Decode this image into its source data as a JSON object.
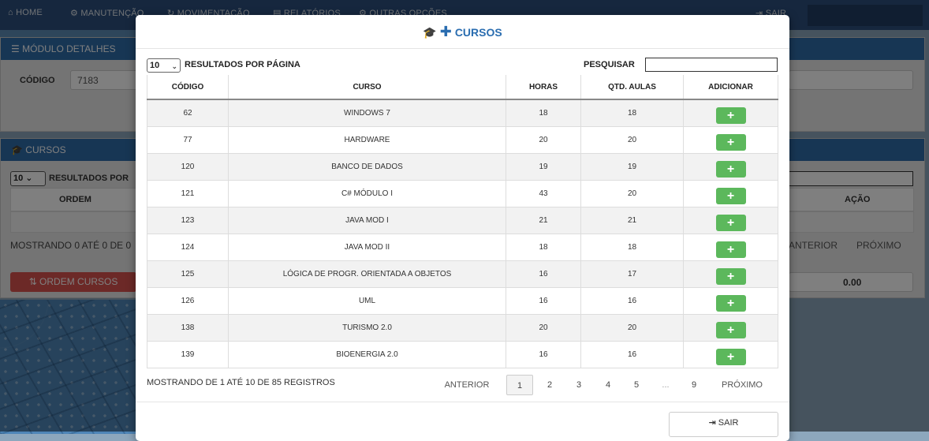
{
  "navbar": {
    "items": [
      {
        "icon": "home-icon",
        "glyph": "⌂",
        "label": "HOME"
      },
      {
        "icon": "gear-icon",
        "glyph": "⚙",
        "label": "MANUTENÇÃO"
      },
      {
        "icon": "refresh-icon",
        "glyph": "↻",
        "label": "MOVIMENTAÇÃO"
      },
      {
        "icon": "document-icon",
        "glyph": "▤",
        "label": "RELATÓRIOS"
      },
      {
        "icon": "gears-icon",
        "glyph": "⚙",
        "label": "OUTRAS OPÇÕES"
      }
    ],
    "exit_label": "SAIR"
  },
  "background": {
    "module_panel_title": "MÓDULO DETALHES",
    "code_label": "CÓDIGO",
    "code_value": "7183",
    "courses_panel_title": "CURSOS",
    "page_size": "10",
    "per_page_label": "RESULTADOS POR",
    "col_order": "ORDEM",
    "col_action": "AÇÃO",
    "showing_text": "MOSTRANDO 0 ATÉ 0 DE 0",
    "prev_label": "ANTERIOR",
    "next_label": "PRÓXIMO",
    "order_button": "ORDEM CURSOS",
    "total_value": "0.00"
  },
  "modal": {
    "title": "CURSOS",
    "page_size": "10",
    "per_page_label": "RESULTADOS POR PÁGINA",
    "search_label": "PESQUISAR",
    "search_value": "",
    "columns": [
      "CÓDIGO",
      "CURSO",
      "HORAS",
      "QTD. AULAS",
      "ADICIONAR"
    ],
    "rows": [
      {
        "code": "62",
        "course": "WINDOWS 7",
        "hours": "18",
        "lessons": "18"
      },
      {
        "code": "77",
        "course": "HARDWARE",
        "hours": "20",
        "lessons": "20"
      },
      {
        "code": "120",
        "course": "BANCO DE DADOS",
        "hours": "19",
        "lessons": "19"
      },
      {
        "code": "121",
        "course": "C# MÓDULO I",
        "hours": "43",
        "lessons": "20"
      },
      {
        "code": "123",
        "course": "JAVA MOD I",
        "hours": "21",
        "lessons": "21"
      },
      {
        "code": "124",
        "course": "JAVA MOD II",
        "hours": "18",
        "lessons": "18"
      },
      {
        "code": "125",
        "course": "LÓGICA DE PROGR. ORIENTADA A OBJETOS",
        "hours": "16",
        "lessons": "17"
      },
      {
        "code": "126",
        "course": "UML",
        "hours": "16",
        "lessons": "16"
      },
      {
        "code": "138",
        "course": "TURISMO 2.0",
        "hours": "20",
        "lessons": "20"
      },
      {
        "code": "139",
        "course": "BIOENERGIA 2.0",
        "hours": "16",
        "lessons": "16"
      }
    ],
    "add_glyph": "+",
    "footer_info": "MOSTRANDO DE 1 ATÉ 10 DE 85 REGISTROS",
    "pagination": {
      "prev": "ANTERIOR",
      "pages": [
        "1",
        "2",
        "3",
        "4",
        "5",
        "...",
        "9"
      ],
      "active_page": "1",
      "next": "PRÓXIMO"
    },
    "exit_label": "SAIR"
  },
  "colors": {
    "navbar": "#2c4f7c",
    "panel_header": "#2f6ca8",
    "title_blue": "#2a6db0",
    "add_green": "#5cb85c",
    "danger_red": "#d9534f"
  }
}
